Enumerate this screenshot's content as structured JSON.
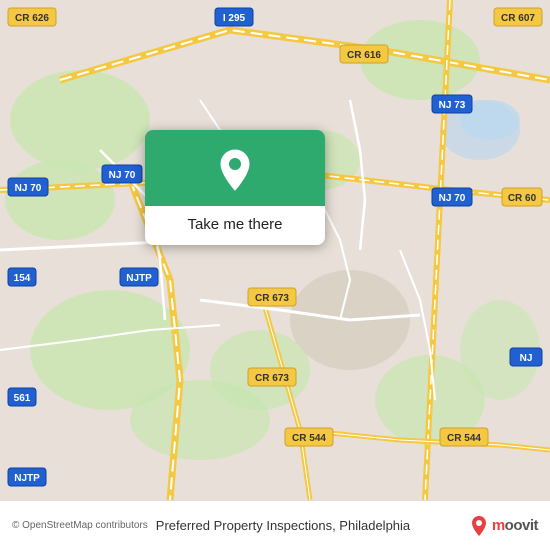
{
  "map": {
    "background_color": "#e8e0d8",
    "road_color": "#ffffff",
    "highway_color": "#f0c040",
    "green_color": "#c8e6b0",
    "water_color": "#a8d4e8"
  },
  "popup": {
    "button_label": "Take me there",
    "top_bg": "#2eaa6e",
    "pin_color": "#ffffff"
  },
  "bottom_bar": {
    "copyright": "© OpenStreetMap contributors",
    "location": "Preferred Property Inspections, Philadelphia",
    "moovit_label": "moovit"
  },
  "road_labels": [
    {
      "id": "cr626",
      "text": "CR 626"
    },
    {
      "id": "i295",
      "text": "I 295"
    },
    {
      "id": "cr607",
      "text": "CR 607"
    },
    {
      "id": "cr616",
      "text": "CR 616"
    },
    {
      "id": "nj70a",
      "text": "NJ 70"
    },
    {
      "id": "nj70b",
      "text": "NJ 70"
    },
    {
      "id": "nj70c",
      "text": "NJ 70"
    },
    {
      "id": "nj73",
      "text": "NJ 73"
    },
    {
      "id": "cr673a",
      "text": "CR 673"
    },
    {
      "id": "cr673b",
      "text": "CR 673"
    },
    {
      "id": "cr544a",
      "text": "CR 544"
    },
    {
      "id": "cr544b",
      "text": "CR 544"
    },
    {
      "id": "label154",
      "text": "154"
    },
    {
      "id": "label561",
      "text": "561"
    },
    {
      "id": "njtp",
      "text": "NJTP"
    }
  ]
}
